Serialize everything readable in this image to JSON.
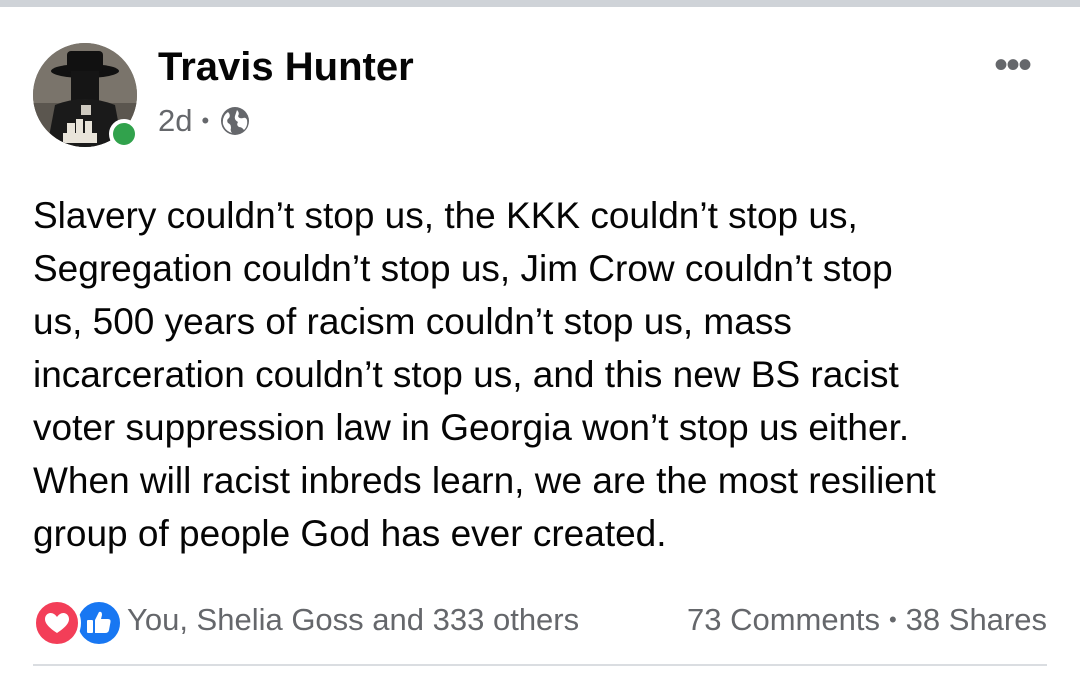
{
  "post": {
    "author": "Travis Hunter",
    "time": "2d",
    "meta_separator": "•",
    "privacy_icon": "globe-icon",
    "more_icon": "more-options-icon",
    "more_glyph": "•••",
    "text_lines": [
      "Slavery couldn’t stop us, the KKK couldn’t stop us,",
      "Segregation couldn’t stop us, Jim Crow couldn’t stop",
      "us, 500 years of racism couldn’t stop us, mass",
      "incarceration couldn’t stop us, and this new BS racist",
      "voter suppression law in Georgia won’t stop us either.",
      "When will racist inbreds learn, we are the most resilient",
      "group of people God has ever created."
    ]
  },
  "footer": {
    "reactions": [
      "love",
      "like"
    ],
    "reactors": "You, Shelia Goss and 333 others",
    "comments": "73 Comments",
    "separator": "•",
    "shares": "38 Shares"
  },
  "colors": {
    "online": "#31a24c",
    "like": "#1877f2",
    "love": "#f33e58",
    "secondary_text": "#65676b"
  }
}
